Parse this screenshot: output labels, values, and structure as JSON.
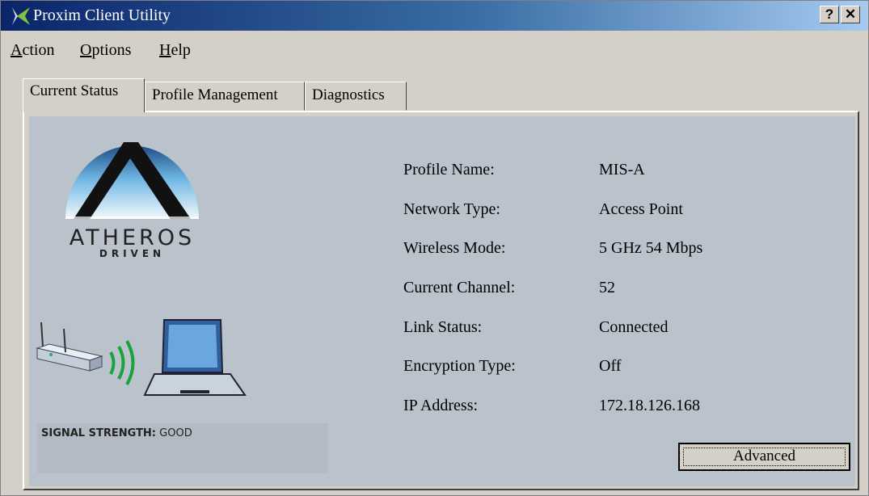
{
  "window": {
    "title": "Proxim Client Utility",
    "help_glyph": "?",
    "close_glyph": "✕"
  },
  "menu": {
    "items": [
      "Action",
      "Options",
      "Help"
    ],
    "accelerators": [
      "A",
      "O",
      "H"
    ]
  },
  "tabs": [
    {
      "label": "Current Status",
      "active": true
    },
    {
      "label": "Profile Management",
      "active": false
    },
    {
      "label": "Diagnostics",
      "active": false
    }
  ],
  "logo": {
    "word": "ATHEROS",
    "sub": "DRIVEN"
  },
  "status": {
    "fields": [
      {
        "label": "Profile Name:",
        "value": "MIS-A"
      },
      {
        "label": "Network Type:",
        "value": "Access Point"
      },
      {
        "label": "Wireless Mode:",
        "value": "5 GHz 54 Mbps"
      },
      {
        "label": "Current Channel:",
        "value": "52"
      },
      {
        "label": "Link Status:",
        "value": "Connected"
      },
      {
        "label": "Encryption Type:",
        "value": "Off"
      },
      {
        "label": "IP Address:",
        "value": "172.18.126.168"
      }
    ]
  },
  "signal": {
    "label": "SIGNAL STRENGTH:",
    "value": "GOOD"
  },
  "buttons": {
    "advanced": "Advanced"
  },
  "colors": {
    "panel_bg": "#bac3cc",
    "wave_green": "#1aa33a",
    "title_dark": "#0a246a"
  },
  "icons": [
    "proxim-x-icon",
    "help-icon",
    "close-icon",
    "atheros-logo-icon",
    "access-point-icon",
    "signal-waves-icon",
    "laptop-icon"
  ]
}
